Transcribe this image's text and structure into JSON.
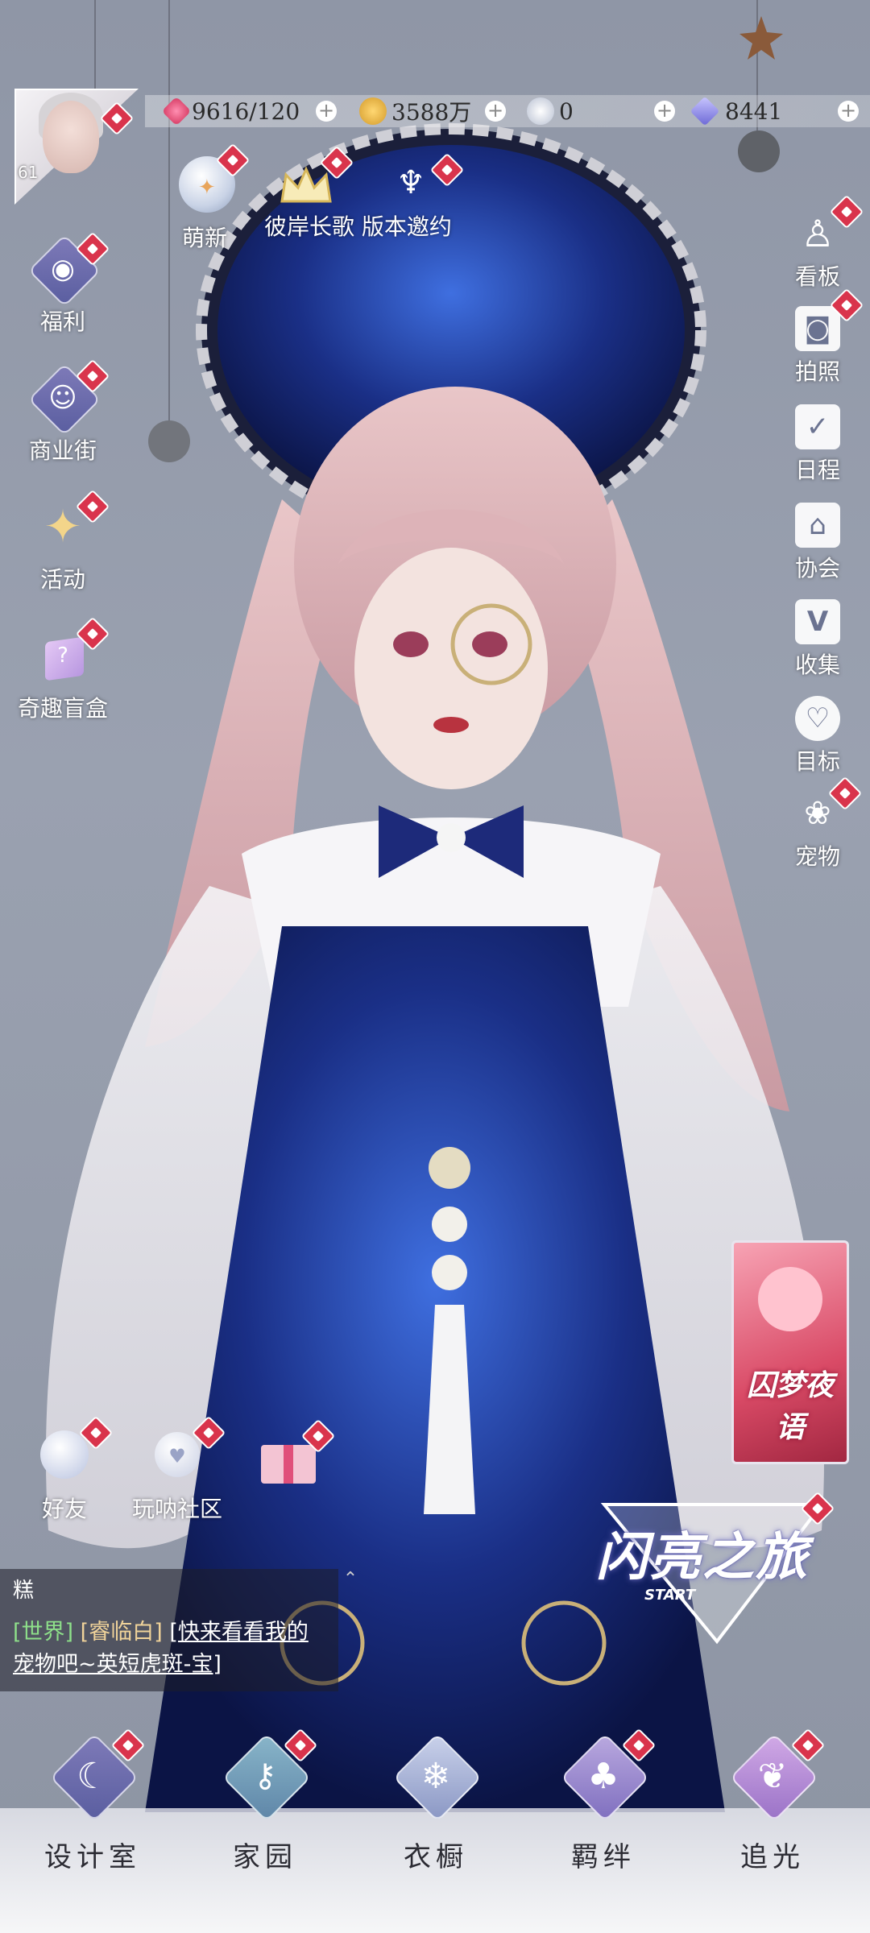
{
  "player": {
    "level": "61"
  },
  "resources": [
    {
      "name": "stamina",
      "value": "9616/120",
      "icon": "heart-gem-icon"
    },
    {
      "name": "gold",
      "value": "3588万",
      "icon": "gold-coin-icon"
    },
    {
      "name": "crystal",
      "value": "0",
      "icon": "snow-crystal-icon"
    },
    {
      "name": "diamond",
      "value": "8441",
      "icon": "diamond-icon"
    }
  ],
  "top_events": {
    "newbie": "萌新",
    "invite": "彼岸长歌 版本邀约"
  },
  "left_menu": [
    {
      "label": "福利",
      "icon": "balloon-icon"
    },
    {
      "label": "商业街",
      "icon": "shopping-bag-icon"
    },
    {
      "label": "活动",
      "icon": "stars-icon"
    },
    {
      "label": "奇趣盲盒",
      "icon": "mystery-box-icon"
    }
  ],
  "right_menu": [
    {
      "label": "看板",
      "icon": "figure-icon"
    },
    {
      "label": "拍照",
      "icon": "camera-icon"
    },
    {
      "label": "日程",
      "icon": "calendar-check-icon"
    },
    {
      "label": "协会",
      "icon": "building-icon"
    },
    {
      "label": "收集",
      "icon": "v-badge-icon"
    },
    {
      "label": "目标",
      "icon": "medal-icon"
    },
    {
      "label": "宠物",
      "icon": "paw-icon"
    }
  ],
  "social": {
    "friends": "好友",
    "community": "玩呐社区",
    "gift": "gift-box-icon"
  },
  "chat": {
    "sender": "糕",
    "channel": "[世界]",
    "user": "[睿临白]",
    "message_part1": "[快来看看我的",
    "message_part2": "宠物吧~英短虎斑-宝]"
  },
  "banner": {
    "title": "囚梦夜语"
  },
  "journey": {
    "title": "闪亮之旅",
    "start": "START"
  },
  "bottom_nav": [
    {
      "label": "设计室",
      "icon": "moon-icon"
    },
    {
      "label": "家园",
      "icon": "key-icon"
    },
    {
      "label": "衣橱",
      "icon": "snowflake-icon"
    },
    {
      "label": "羁绊",
      "icon": "clover-icon"
    },
    {
      "label": "追光",
      "icon": "butterfly-icon"
    }
  ],
  "colors": {
    "notify": "#d9344c",
    "chat_channel": "#8ee08a",
    "chat_user": "#f0d39a",
    "accent_blue": "#1f3f9a"
  }
}
